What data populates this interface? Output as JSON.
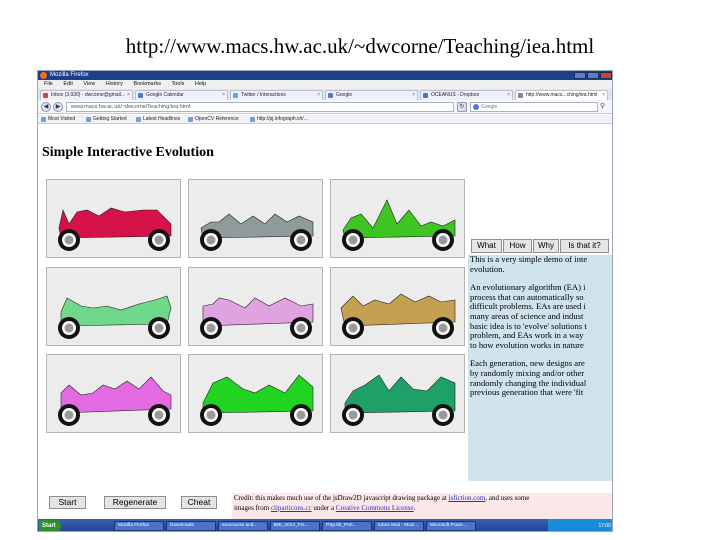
{
  "slide": {
    "title": "http://www.macs.hw.ac.uk/~dwcorne/Teaching/iea.html"
  },
  "browser": {
    "window_title": "Mozilla Firefox",
    "menu": [
      "File",
      "Edit",
      "View",
      "History",
      "Bookmarks",
      "Tools",
      "Help"
    ],
    "tabs": [
      {
        "label": "Inbox (3,930) - dwcorne@gmail...",
        "color": "#d44638"
      },
      {
        "label": "Google Calendar",
        "color": "#4a7be0"
      },
      {
        "label": "Twitter / Interactions",
        "color": "#55acee"
      },
      {
        "label": "Google",
        "color": "#4a7be0"
      },
      {
        "label": "OCEANUS - Dropbox",
        "color": "#2f7fd6"
      },
      {
        "label": "http://www.macs...ching/iea.html",
        "color": "#888888"
      }
    ],
    "url": "www.macs.hw.ac.uk/~dwcorne/Teaching/iea.html",
    "search_placeholder": "Google",
    "bookmarks": [
      "Most Visited",
      "Getting Started",
      "Latest Headlines",
      "OpenCV Reference",
      "http://pj.infograph.ch/..."
    ]
  },
  "page": {
    "heading": "Simple Interactive Evolution",
    "cars": [
      {
        "name": "car-1",
        "color": "#d6124a"
      },
      {
        "name": "car-2",
        "color": "#8f9a9a"
      },
      {
        "name": "car-3",
        "color": "#3ec522"
      },
      {
        "name": "car-4",
        "color": "#37c56a"
      },
      {
        "name": "car-5",
        "color": "#6fd88a"
      },
      {
        "name": "car-6",
        "color": "#e0a2e0"
      },
      {
        "name": "car-7",
        "color": "#c6a052"
      },
      {
        "name": "car-8",
        "color": "#e46ae4"
      },
      {
        "name": "car-9",
        "color": "#22d422"
      },
      {
        "name": "car-10",
        "color": "#1fa066"
      }
    ],
    "buttons": {
      "start": "Start",
      "regenerate": "Regenerate",
      "cheat": "Cheat"
    },
    "info_tabs": [
      "What",
      "How",
      "Why",
      "Is that it?"
    ],
    "info_text": [
      [
        "This is a very simple demo of inte",
        "evolution."
      ],
      [
        "An evolutionary algorithm (EA) i",
        "process that can automatically so",
        "difficult problems. EAs are used i",
        "many areas of science and indust",
        "basic idea is to 'evolve' solutions t",
        "problem, and EAs work in a way",
        "to how evolution works in nature"
      ],
      [
        "Each generation, new designs are",
        "by randomly mixing and/or other",
        "randomly changing the individual",
        "previous generation that were 'fit"
      ]
    ],
    "credit": {
      "prefix": "Credit: this makes much use of the jsDraw2D javascript drawing package at ",
      "link1": "jsfiction.com",
      "middle": ", and uses some",
      "line2_prefix": "images from ",
      "link2": "cliparticons.cc",
      "line2_middle": " under a ",
      "link3": "Creative Commons License",
      "line2_suffix": "."
    }
  },
  "taskbar": {
    "start": "Start",
    "tasks": [
      "Mozilla Firefox",
      "Downloads",
      "evocourse and...",
      "BIE_2014_Fin...",
      "PSp.lbl_Prel...",
      "Inbox Mail - Mozi...",
      "Microsoft Powe..."
    ],
    "clock": "17:00"
  }
}
